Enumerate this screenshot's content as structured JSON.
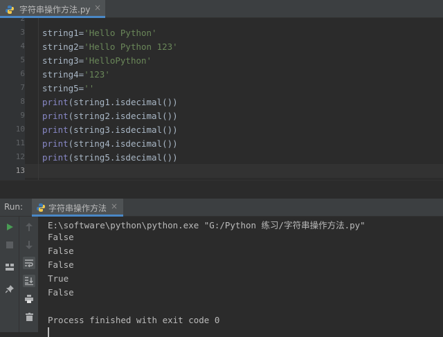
{
  "editor_tab": {
    "filename": "字符串操作方法.py",
    "close": "×"
  },
  "line_numbers": [
    "2",
    "3",
    "4",
    "5",
    "6",
    "7",
    "8",
    "9",
    "10",
    "11",
    "12",
    "13"
  ],
  "code": {
    "l3": {
      "var": "string1=",
      "str": "'Hello Python'"
    },
    "l4": {
      "var": "string2=",
      "str": "'Hello Python 123'"
    },
    "l5": {
      "var": "string3=",
      "str": "'HelloPython'"
    },
    "l6": {
      "var": "string4=",
      "str": "'123'"
    },
    "l7": {
      "var": "string5=",
      "str": "''"
    },
    "l8": {
      "kw": "print",
      "rest": "(string1.isdecimal())"
    },
    "l9": {
      "kw": "print",
      "rest": "(string2.isdecimal())"
    },
    "l10": {
      "kw": "print",
      "rest": "(string3.isdecimal())"
    },
    "l11": {
      "kw": "print",
      "rest": "(string4.isdecimal())"
    },
    "l12": {
      "kw": "print",
      "rest": "(string5.isdecimal())"
    }
  },
  "run_panel": {
    "label": "Run:",
    "tab_label": "字符串操作方法",
    "close": "×"
  },
  "console": {
    "lines": [
      "E:\\software\\python\\python.exe \"G:/Python 练习/字符串操作方法.py\"",
      "False",
      "False",
      "False",
      "True",
      "False",
      "",
      "Process finished with exit code 0"
    ]
  },
  "colors": {
    "background": "#2b2b2b",
    "string": "#6a8759",
    "builtin": "#8888c6",
    "text": "#a9b7c6",
    "accent": "#4a88c7",
    "run_green": "#499c54"
  },
  "icons": [
    "python-file-icon",
    "close-icon",
    "run-icon",
    "stop-icon",
    "layout-icon",
    "pin-icon",
    "up-arrow-icon",
    "down-arrow-icon",
    "soft-wrap-icon",
    "scroll-to-end-icon",
    "print-icon",
    "trash-icon"
  ]
}
